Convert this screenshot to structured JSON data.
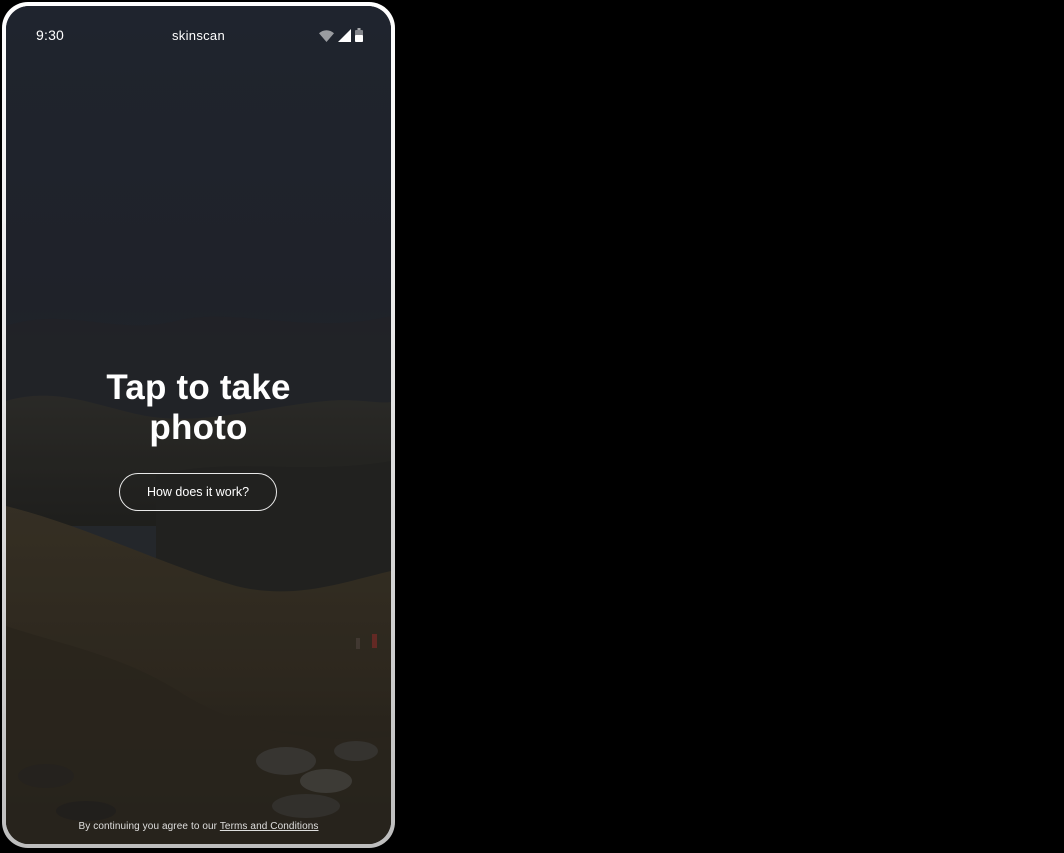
{
  "status_bar": {
    "time": "9:30",
    "app_name": "skinscan",
    "icons": [
      "wifi-icon",
      "cellular-signal-icon",
      "battery-icon"
    ]
  },
  "hero": {
    "title": "Tap to take photo"
  },
  "how_button": {
    "label": "How does it work?"
  },
  "footer": {
    "prefix": "By continuing you agree to our",
    "terms_link": "Terms and Conditions"
  },
  "colors": {
    "background": "#000000",
    "text": "#ffffff",
    "frame": "#e9e9e9"
  }
}
